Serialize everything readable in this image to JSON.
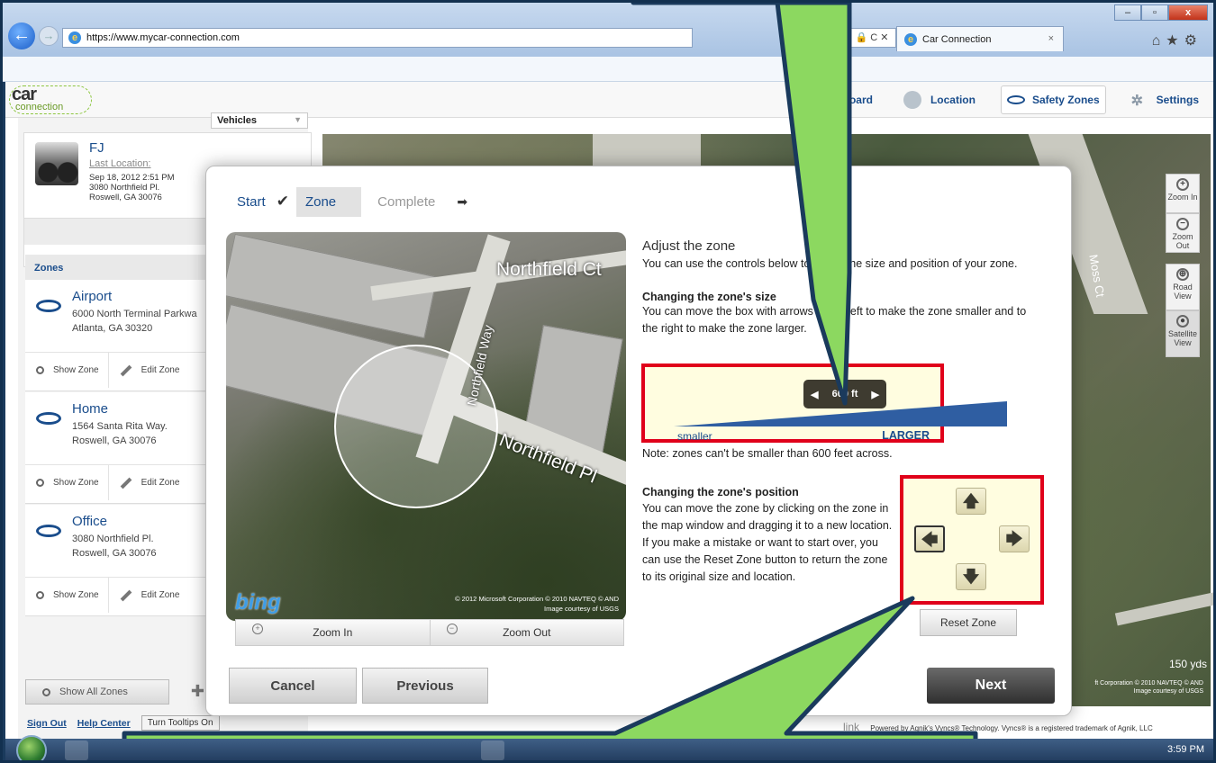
{
  "browser": {
    "url": "https://www.mycar-connection.com",
    "tab_title": "Car Connection",
    "tab_close": "×",
    "addr_right": "🔒 C ✕"
  },
  "header": {
    "logo_line1": "car",
    "logo_line2": "connection",
    "nav": [
      {
        "label": "shboard"
      },
      {
        "label": "Location"
      },
      {
        "label": "Safety Zones"
      },
      {
        "label": "Settings"
      }
    ]
  },
  "sidebar": {
    "vehicles_label": "Vehicles",
    "vehicle": {
      "name": "FJ",
      "last_location_label": "Last Location:",
      "time": "Sep 18, 2012 2:51 PM",
      "addr1": "3080 Northfield Pl.",
      "addr2": "Roswell, GA 30076"
    },
    "zones_header": "Zones",
    "zones": [
      {
        "name": "Airport",
        "addr1": "6000 North Terminal Parkwa",
        "addr2": "Atlanta, GA 30320"
      },
      {
        "name": "Home",
        "addr1": "1564 Santa Rita Way.",
        "addr2": "Roswell, GA 30076"
      },
      {
        "name": "Office",
        "addr1": "3080 Northfield Pl.",
        "addr2": "Roswell, GA 30076"
      }
    ],
    "show_zone": "Show Zone",
    "edit_zone": "Edit Zone",
    "show_all": "Show All Zones",
    "sign_out": "Sign Out",
    "help_center": "Help Center",
    "tooltips": "Turn Tooltips On"
  },
  "map": {
    "zoom_in": "Zoom In",
    "zoom_out": "Zoom Out",
    "road_view": "Road View",
    "satellite_view": "Satellite View",
    "scale": "150 yds",
    "credit_line1": "ft Corporation © 2010 NAVTEQ © AND",
    "credit_line2": "Image courtesy of USGS",
    "street": "Moss Ct",
    "footer_brand": "link",
    "footer_text": "Powered by Agnik's Vyncs® Technology. Vyncs® is a registered trademark of Agnik, LLC"
  },
  "modal": {
    "steps": {
      "start": "Start",
      "zone": "Zone",
      "complete": "Complete"
    },
    "satmap": {
      "street1": "Northfield Ct",
      "street2": "Northfield Way",
      "street3": "Northfield Pl",
      "bing": "bing",
      "credit1": "© 2012 Microsoft Corporation   © 2010 NAVTEQ   © AND",
      "credit2": "Image courtesy of USGS",
      "zoom_in": "Zoom In",
      "zoom_out": "Zoom Out"
    },
    "title": "Adjust the zone",
    "intro": "You can use the controls below to adjust the size and position of your zone.",
    "size_heading": "Changing the zone's size",
    "size_text": "You can move the box with arrows to the left to make the zone smaller and to the right to make the zone larger.",
    "slider_value": "600 ft",
    "slider_smaller": "smaller",
    "slider_larger": "LARGER",
    "note": "Note: zones can't be smaller than 600 feet across.",
    "pos_heading": "Changing the zone's position",
    "pos_text": "You can move the zone by clicking on the zone in the map window and dragging it to a new location. If you make a mistake or want to start over, you can use the Reset Zone button to return the zone to its original size and location.",
    "reset": "Reset Zone",
    "cancel": "Cancel",
    "previous": "Previous",
    "next": "Next"
  },
  "taskbar": {
    "time": "3:59 PM"
  },
  "colors": {
    "accent_blue": "#1a4d8c",
    "highlight_red": "#e0001a",
    "callout_green": "#8cd860"
  }
}
